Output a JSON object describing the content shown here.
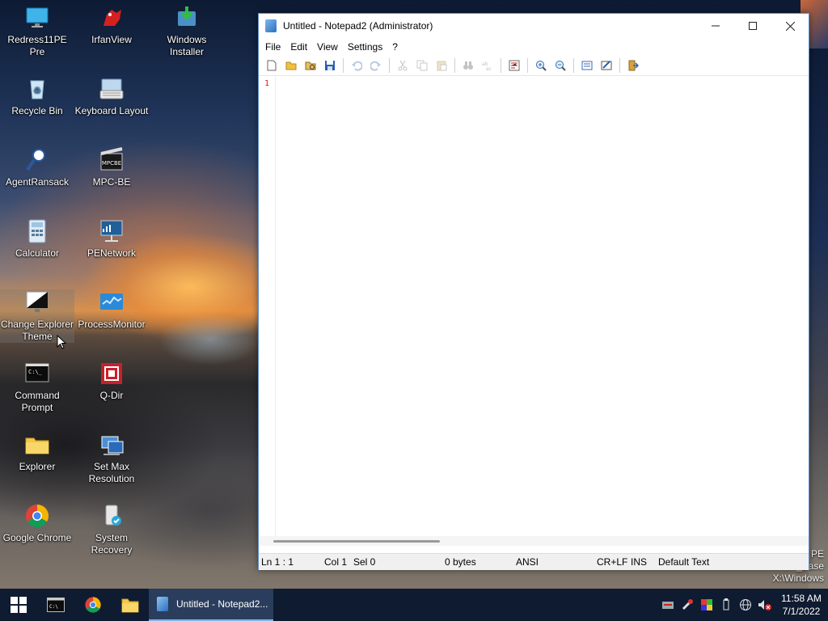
{
  "desktop": {
    "icons": [
      {
        "label": "Redress11PE Pre",
        "icon": "monitor-icon"
      },
      {
        "label": "IrfanView",
        "icon": "irfanview-icon"
      },
      {
        "label": "Windows Installer",
        "icon": "windows-installer-icon"
      },
      {
        "label": "Recycle Bin",
        "icon": "recycle-bin-icon"
      },
      {
        "label": "Keyboard Layout",
        "icon": "keyboard-icon"
      },
      {
        "label": "AgentRansack",
        "icon": "agent-ransack-icon"
      },
      {
        "label": "MPC-BE",
        "icon": "mpc-be-icon"
      },
      {
        "label": "Calculator",
        "icon": "calculator-icon"
      },
      {
        "label": "PENetwork",
        "icon": "network-icon"
      },
      {
        "label": "Change Explorer Theme",
        "icon": "theme-icon"
      },
      {
        "label": "ProcessMonitor",
        "icon": "process-monitor-icon"
      },
      {
        "label": "Command Prompt",
        "icon": "command-prompt-icon"
      },
      {
        "label": "Q-Dir",
        "icon": "q-dir-icon"
      },
      {
        "label": "Explorer",
        "icon": "folder-icon"
      },
      {
        "label": "Set Max Resolution",
        "icon": "resolution-icon"
      },
      {
        "label": "Google Chrome",
        "icon": "chrome-icon"
      },
      {
        "label": "System Recovery",
        "icon": "system-recovery-icon"
      }
    ],
    "build_text": [
      "PE",
      "_Base",
      "X:\\Windows"
    ]
  },
  "notepad": {
    "title": "Untitled - Notepad2 (Administrator)",
    "menu": [
      "File",
      "Edit",
      "View",
      "Settings",
      "?"
    ],
    "line_number": "1",
    "status": {
      "position": "Ln 1 : 1",
      "col": "Col 1",
      "sel": "Sel 0",
      "size": "0 bytes",
      "encoding": "ANSI",
      "eol": "CR+LF",
      "mode": "INS",
      "scheme": "Default Text"
    }
  },
  "taskbar": {
    "notepad_label": "Untitled - Notepad2...",
    "time": "11:58 AM",
    "date": "7/1/2022"
  },
  "colors": {
    "taskbar": "#0f1b30",
    "accent": "#7fb4e8",
    "line_number": "#d21e1e"
  }
}
